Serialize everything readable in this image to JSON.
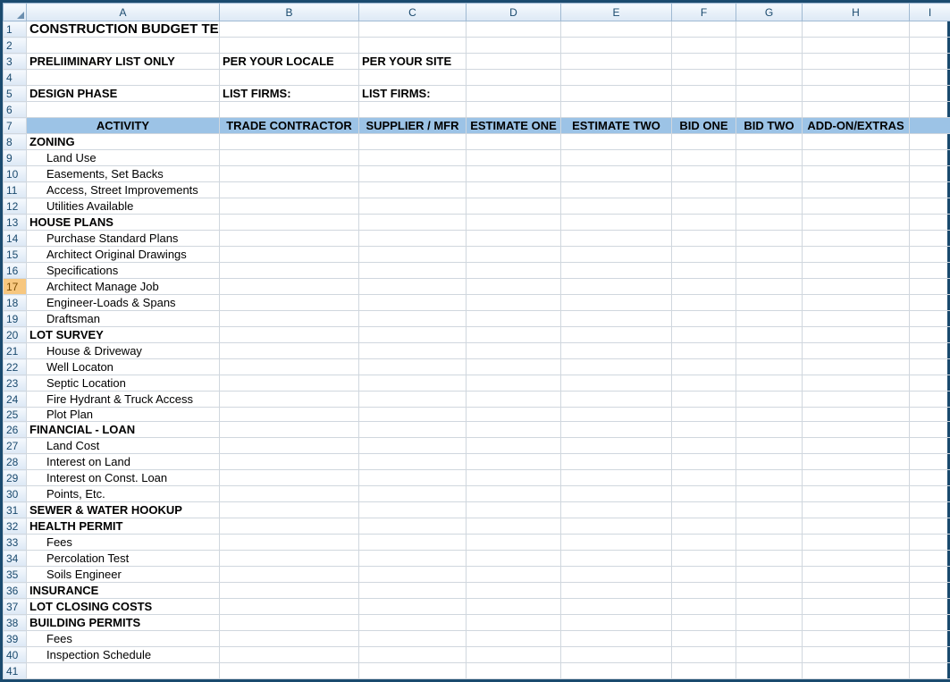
{
  "columns": [
    "A",
    "B",
    "C",
    "D",
    "E",
    "F",
    "G",
    "H",
    "I"
  ],
  "rows": [
    {
      "n": 1,
      "cells": [
        "CONSTRUCTION BUDGET TEMPLATE",
        "",
        "",
        "",
        "",
        "",
        "",
        "",
        ""
      ],
      "style": {
        "0": "bold",
        "fs": "15"
      }
    },
    {
      "n": 2,
      "cells": [
        "",
        "",
        "",
        "",
        "",
        "",
        "",
        "",
        ""
      ]
    },
    {
      "n": 3,
      "cells": [
        "PRELIIMINARY LIST ONLY",
        "PER YOUR LOCALE",
        "PER YOUR SITE",
        "",
        "",
        "",
        "",
        "",
        ""
      ],
      "style": {
        "0": "bold",
        "1": "bold",
        "2": "bold"
      }
    },
    {
      "n": 4,
      "cells": [
        "",
        "",
        "",
        "",
        "",
        "",
        "",
        "",
        ""
      ]
    },
    {
      "n": 5,
      "cells": [
        "DESIGN PHASE",
        "LIST FIRMS:",
        "LIST FIRMS:",
        "",
        "",
        "",
        "",
        "",
        ""
      ],
      "style": {
        "0": "bold center",
        "1": "bold center",
        "2": "bold center"
      }
    },
    {
      "n": 6,
      "cells": [
        "",
        "",
        "",
        "",
        "",
        "",
        "",
        "",
        ""
      ]
    },
    {
      "n": 7,
      "band": true,
      "cells": [
        "ACTIVITY",
        "TRADE CONTRACTOR",
        "SUPPLIER / MFR",
        "ESTIMATE ONE",
        "ESTIMATE TWO",
        "BID ONE",
        "BID TWO",
        "ADD-ON/EXTRAS",
        ""
      ]
    },
    {
      "n": 8,
      "cells": [
        "ZONING",
        "",
        "",
        "",
        "",
        "",
        "",
        "",
        ""
      ],
      "style": {
        "0": "bold"
      }
    },
    {
      "n": 9,
      "cells": [
        "Land Use",
        "",
        "",
        "",
        "",
        "",
        "",
        "",
        ""
      ],
      "indent": true
    },
    {
      "n": 10,
      "cells": [
        "Easements, Set Backs",
        "",
        "",
        "",
        "",
        "",
        "",
        "",
        ""
      ],
      "indent": true
    },
    {
      "n": 11,
      "cells": [
        "Access, Street Improvements",
        "",
        "",
        "",
        "",
        "",
        "",
        "",
        ""
      ],
      "indent": true
    },
    {
      "n": 12,
      "cells": [
        "Utilities Available",
        "",
        "",
        "",
        "",
        "",
        "",
        "",
        ""
      ],
      "indent": true
    },
    {
      "n": 13,
      "cells": [
        "HOUSE PLANS",
        "",
        "",
        "",
        "",
        "",
        "",
        "",
        ""
      ],
      "style": {
        "0": "bold"
      }
    },
    {
      "n": 14,
      "cells": [
        "Purchase Standard Plans",
        "",
        "",
        "",
        "",
        "",
        "",
        "",
        ""
      ],
      "indent": true
    },
    {
      "n": 15,
      "cells": [
        "Architect Original Drawings",
        "",
        "",
        "",
        "",
        "",
        "",
        "",
        ""
      ],
      "indent": true
    },
    {
      "n": 16,
      "cells": [
        "Specifications",
        "",
        "",
        "",
        "",
        "",
        "",
        "",
        ""
      ],
      "indent": true
    },
    {
      "n": 17,
      "cells": [
        "Architect Manage Job",
        "",
        "",
        "",
        "",
        "",
        "",
        "",
        ""
      ],
      "indent": true,
      "sel": true
    },
    {
      "n": 18,
      "cells": [
        "Engineer-Loads & Spans",
        "",
        "",
        "",
        "",
        "",
        "",
        "",
        ""
      ],
      "indent": true
    },
    {
      "n": 19,
      "cells": [
        "Draftsman",
        "",
        "",
        "",
        "",
        "",
        "",
        "",
        ""
      ],
      "indent": true
    },
    {
      "n": 20,
      "cells": [
        "LOT SURVEY",
        "",
        "",
        "",
        "",
        "",
        "",
        "",
        ""
      ],
      "style": {
        "0": "bold"
      }
    },
    {
      "n": 21,
      "cells": [
        "House & Driveway",
        "",
        "",
        "",
        "",
        "",
        "",
        "",
        ""
      ],
      "indent": true
    },
    {
      "n": 22,
      "cells": [
        "Well Locaton",
        "",
        "",
        "",
        "",
        "",
        "",
        "",
        ""
      ],
      "indent": true
    },
    {
      "n": 23,
      "cells": [
        "Septic Location",
        "",
        "",
        "",
        "",
        "",
        "",
        "",
        ""
      ],
      "indent": true
    },
    {
      "n": 24,
      "cells": [
        "Fire Hydrant & Truck Access",
        "",
        "",
        "",
        "",
        "",
        "",
        "",
        ""
      ],
      "indent": true
    },
    {
      "n": 25,
      "cells": [
        "Plot Plan",
        "",
        "",
        "",
        "",
        "",
        "",
        "",
        ""
      ],
      "indent": true,
      "short": true
    },
    {
      "n": 26,
      "cells": [
        "FINANCIAL - LOAN",
        "",
        "",
        "",
        "",
        "",
        "",
        "",
        ""
      ],
      "style": {
        "0": "bold"
      }
    },
    {
      "n": 27,
      "cells": [
        "Land Cost",
        "",
        "",
        "",
        "",
        "",
        "",
        "",
        ""
      ],
      "indent": true
    },
    {
      "n": 28,
      "cells": [
        "Interest on Land",
        "",
        "",
        "",
        "",
        "",
        "",
        "",
        ""
      ],
      "indent": true
    },
    {
      "n": 29,
      "cells": [
        "Interest on Const. Loan",
        "",
        "",
        "",
        "",
        "",
        "",
        "",
        ""
      ],
      "indent": true
    },
    {
      "n": 30,
      "cells": [
        "Points, Etc.",
        "",
        "",
        "",
        "",
        "",
        "",
        "",
        ""
      ],
      "indent": true
    },
    {
      "n": 31,
      "cells": [
        "SEWER & WATER HOOKUP",
        "",
        "",
        "",
        "",
        "",
        "",
        "",
        ""
      ],
      "style": {
        "0": "bold"
      }
    },
    {
      "n": 32,
      "cells": [
        "HEALTH PERMIT",
        "",
        "",
        "",
        "",
        "",
        "",
        "",
        ""
      ],
      "style": {
        "0": "bold"
      }
    },
    {
      "n": 33,
      "cells": [
        "Fees",
        "",
        "",
        "",
        "",
        "",
        "",
        "",
        ""
      ],
      "indent": true
    },
    {
      "n": 34,
      "cells": [
        "Percolation Test",
        "",
        "",
        "",
        "",
        "",
        "",
        "",
        ""
      ],
      "indent": true
    },
    {
      "n": 35,
      "cells": [
        "Soils Engineer",
        "",
        "",
        "",
        "",
        "",
        "",
        "",
        ""
      ],
      "indent": true
    },
    {
      "n": 36,
      "cells": [
        "INSURANCE",
        "",
        "",
        "",
        "",
        "",
        "",
        "",
        ""
      ],
      "style": {
        "0": "bold"
      }
    },
    {
      "n": 37,
      "cells": [
        "LOT CLOSING COSTS",
        "",
        "",
        "",
        "",
        "",
        "",
        "",
        ""
      ],
      "style": {
        "0": "bold"
      }
    },
    {
      "n": 38,
      "cells": [
        "BUILDING PERMITS",
        "",
        "",
        "",
        "",
        "",
        "",
        "",
        ""
      ],
      "style": {
        "0": "bold"
      }
    },
    {
      "n": 39,
      "cells": [
        "Fees",
        "",
        "",
        "",
        "",
        "",
        "",
        "",
        ""
      ],
      "indent": true
    },
    {
      "n": 40,
      "cells": [
        "Inspection Schedule",
        "",
        "",
        "",
        "",
        "",
        "",
        "",
        ""
      ],
      "indent": true
    },
    {
      "n": 41,
      "cells": [
        "",
        "",
        "",
        "",
        "",
        "",
        "",
        "",
        ""
      ]
    }
  ]
}
